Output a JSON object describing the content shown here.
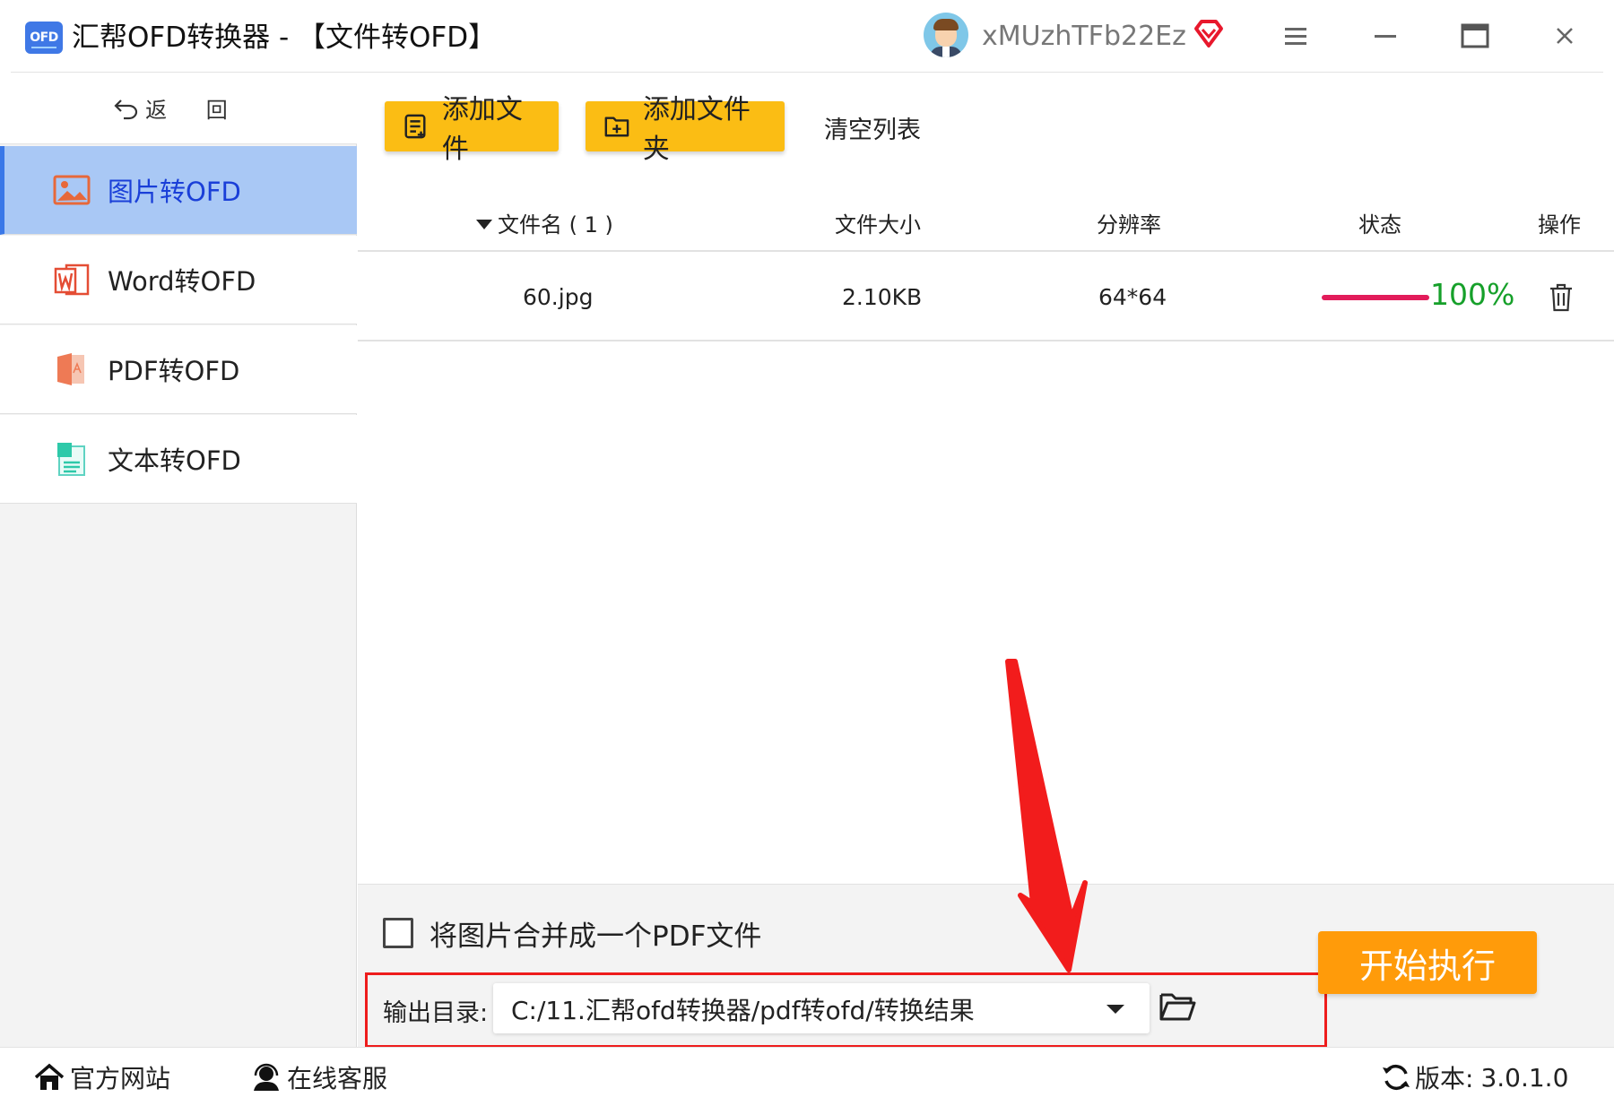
{
  "window": {
    "logo_text": "OFD",
    "title": "汇帮OFD转换器 - 【文件转OFD】",
    "username": "xMUzhTFb22Ez"
  },
  "sidebar": {
    "back_label": "返 回",
    "items": [
      {
        "label": "图片转OFD",
        "icon": "image-icon",
        "active": true
      },
      {
        "label": "Word转OFD",
        "icon": "word-icon",
        "active": false
      },
      {
        "label": "PDF转OFD",
        "icon": "pdf-icon",
        "active": false
      },
      {
        "label": "文本转OFD",
        "icon": "text-file-icon",
        "active": false
      }
    ]
  },
  "toolbar": {
    "add_file_label": "添加文件",
    "add_folder_label": "添加文件夹",
    "clear_label": "清空列表"
  },
  "table": {
    "columns": [
      "文件名 ( 1 )",
      "文件大小",
      "分辨率",
      "状态",
      "操作"
    ],
    "rows": [
      {
        "name": "60.jpg",
        "size": "2.10KB",
        "resolution": "64*64",
        "progress": 1.0,
        "status": "100%"
      }
    ]
  },
  "options": {
    "merge_label": "将图片合并成一个PDF文件",
    "merge_checked": false,
    "output_label": "输出目录:",
    "output_path": "C:/11.汇帮ofd转换器/pdf转ofd/转换结果",
    "start_label": "开始执行"
  },
  "statusbar": {
    "site_label": "官方网站",
    "service_label": "在线客服",
    "version_label": "版本:",
    "version_value": "3.0.1.0"
  },
  "colors": {
    "accent_yellow": "#fbbd14",
    "start_orange": "#ff9b0a",
    "active_bg": "#a9c8f5",
    "active_text": "#1a3fd8",
    "progress_red": "#e21c5a",
    "status_green": "#16a02a",
    "highlight_red": "#ee1c1c"
  }
}
